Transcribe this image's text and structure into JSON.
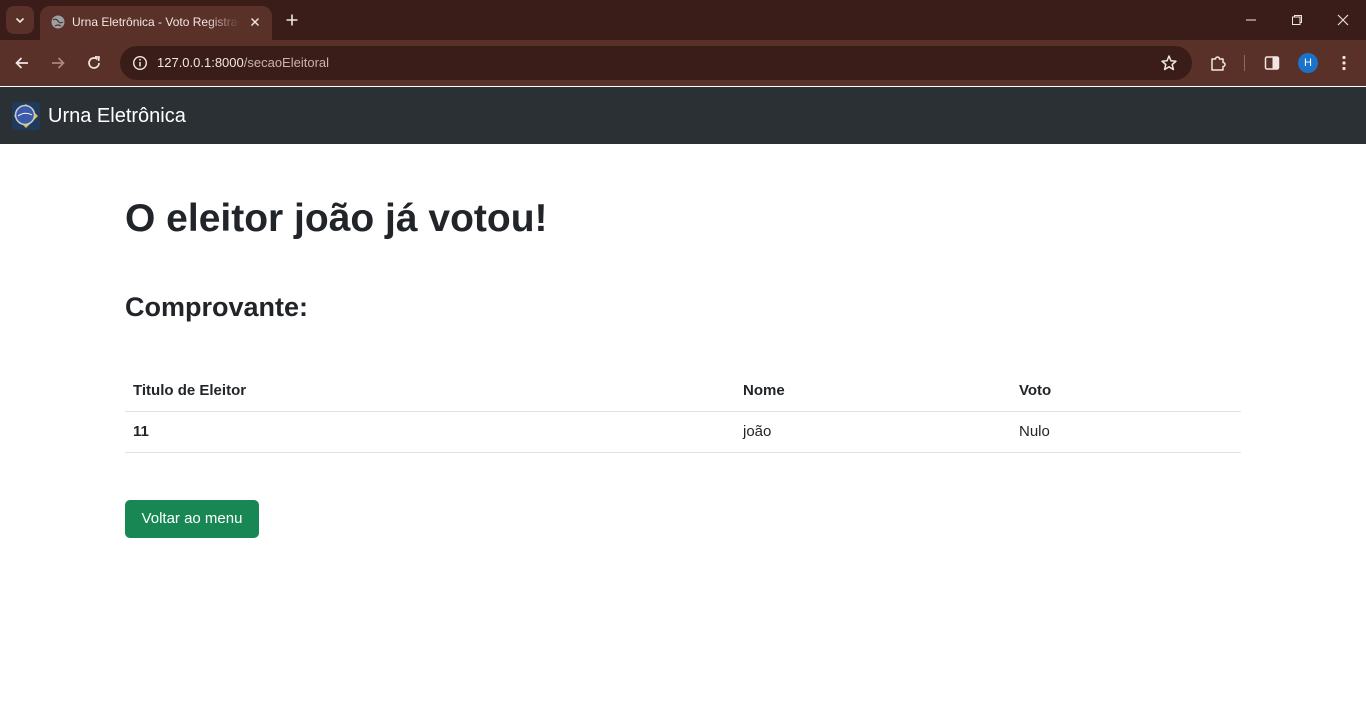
{
  "browser": {
    "tab_title": "Urna Eletrônica - Voto Registrado",
    "url_host": "127.0.0.1:8000",
    "url_path": "/secaoEleitoral",
    "profile_initial": "H",
    "accent_color": "#5a3129"
  },
  "navbar": {
    "brand": "Urna Eletrônica"
  },
  "main": {
    "headline": "O eleitor joão já votou!",
    "subheading": "Comprovante:",
    "table": {
      "columns": [
        "Titulo de Eleitor",
        "Nome",
        "Voto"
      ],
      "rows": [
        {
          "titulo": "11",
          "nome": "joão",
          "voto": "Nulo"
        }
      ]
    },
    "back_button": "Voltar ao menu",
    "button_color": "#198754"
  },
  "icons": {
    "tab_search": "chevron-down-icon",
    "favicon": "globe-icon",
    "tab_close": "close-icon",
    "new_tab": "plus-icon",
    "back": "arrow-left-icon",
    "forward": "arrow-right-icon",
    "reload": "reload-icon",
    "site_info": "info-icon",
    "bookmark": "star-icon",
    "extensions": "puzzle-icon",
    "side_panel": "side-panel-icon",
    "menu": "kebab-menu-icon",
    "minimize": "minimize-icon",
    "restore": "restore-icon",
    "close_window": "close-icon"
  }
}
